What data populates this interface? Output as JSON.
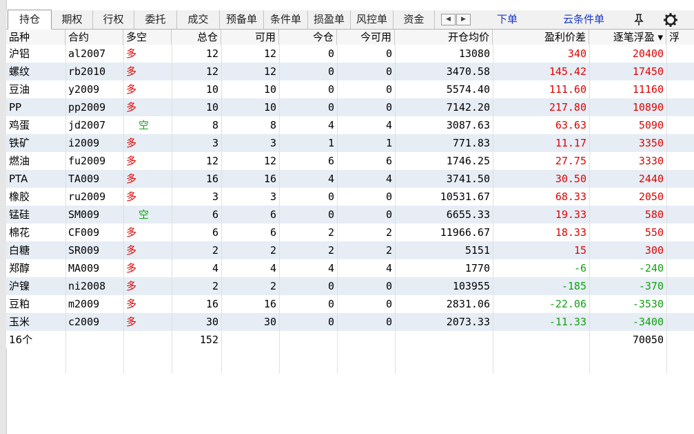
{
  "tabs": [
    {
      "label": "持仓",
      "active": true
    },
    {
      "label": "期权"
    },
    {
      "label": "行权"
    },
    {
      "label": "委托"
    },
    {
      "label": "成交"
    },
    {
      "label": "预备单"
    },
    {
      "label": "条件单"
    },
    {
      "label": "损盈单"
    },
    {
      "label": "风控单"
    },
    {
      "label": "资金"
    }
  ],
  "toolbar": {
    "scroll_left": "◀",
    "scroll_right": "▶",
    "order_link": "下单",
    "cloud_link": "云条件单",
    "pin_icon": "pin-icon",
    "settings_icon": "gear-icon"
  },
  "columns": [
    "品种",
    "合约",
    "多空",
    "总仓",
    "可用",
    "今仓",
    "今可用",
    "开仓均价",
    "盈利价差",
    "逐笔浮盈 ▾",
    "浮"
  ],
  "rows": [
    {
      "variety": "沪铝",
      "contract": "al2007",
      "dir": "多",
      "side": "long",
      "total": "12",
      "avail": "12",
      "today": "0",
      "today_avail": "0",
      "avg_price": "13080",
      "spread": "340",
      "float_pnl": "20400",
      "sign": "pos"
    },
    {
      "variety": "螺纹",
      "contract": "rb2010",
      "dir": "多",
      "side": "long",
      "total": "12",
      "avail": "12",
      "today": "0",
      "today_avail": "0",
      "avg_price": "3470.58",
      "spread": "145.42",
      "float_pnl": "17450",
      "sign": "pos"
    },
    {
      "variety": "豆油",
      "contract": "y2009",
      "dir": "多",
      "side": "long",
      "total": "10",
      "avail": "10",
      "today": "0",
      "today_avail": "0",
      "avg_price": "5574.40",
      "spread": "111.60",
      "float_pnl": "11160",
      "sign": "pos"
    },
    {
      "variety": "PP",
      "contract": "pp2009",
      "dir": "多",
      "side": "long",
      "total": "10",
      "avail": "10",
      "today": "0",
      "today_avail": "0",
      "avg_price": "7142.20",
      "spread": "217.80",
      "float_pnl": "10890",
      "sign": "pos"
    },
    {
      "variety": "鸡蛋",
      "contract": "jd2007",
      "dir": "空",
      "side": "short",
      "total": "8",
      "avail": "8",
      "today": "4",
      "today_avail": "4",
      "avg_price": "3087.63",
      "spread": "63.63",
      "float_pnl": "5090",
      "sign": "pos"
    },
    {
      "variety": "铁矿",
      "contract": "i2009",
      "dir": "多",
      "side": "long",
      "total": "3",
      "avail": "3",
      "today": "1",
      "today_avail": "1",
      "avg_price": "771.83",
      "spread": "11.17",
      "float_pnl": "3350",
      "sign": "pos"
    },
    {
      "variety": "燃油",
      "contract": "fu2009",
      "dir": "多",
      "side": "long",
      "total": "12",
      "avail": "12",
      "today": "6",
      "today_avail": "6",
      "avg_price": "1746.25",
      "spread": "27.75",
      "float_pnl": "3330",
      "sign": "pos"
    },
    {
      "variety": "PTA",
      "contract": "TA009",
      "dir": "多",
      "side": "long",
      "total": "16",
      "avail": "16",
      "today": "4",
      "today_avail": "4",
      "avg_price": "3741.50",
      "spread": "30.50",
      "float_pnl": "2440",
      "sign": "pos"
    },
    {
      "variety": "橡胶",
      "contract": "ru2009",
      "dir": "多",
      "side": "long",
      "total": "3",
      "avail": "3",
      "today": "0",
      "today_avail": "0",
      "avg_price": "10531.67",
      "spread": "68.33",
      "float_pnl": "2050",
      "sign": "pos"
    },
    {
      "variety": "锰硅",
      "contract": "SM009",
      "dir": "空",
      "side": "short",
      "total": "6",
      "avail": "6",
      "today": "0",
      "today_avail": "0",
      "avg_price": "6655.33",
      "spread": "19.33",
      "float_pnl": "580",
      "sign": "pos"
    },
    {
      "variety": "棉花",
      "contract": "CF009",
      "dir": "多",
      "side": "long",
      "total": "6",
      "avail": "6",
      "today": "2",
      "today_avail": "2",
      "avg_price": "11966.67",
      "spread": "18.33",
      "float_pnl": "550",
      "sign": "pos"
    },
    {
      "variety": "白糖",
      "contract": "SR009",
      "dir": "多",
      "side": "long",
      "total": "2",
      "avail": "2",
      "today": "2",
      "today_avail": "2",
      "avg_price": "5151",
      "spread": "15",
      "float_pnl": "300",
      "sign": "pos"
    },
    {
      "variety": "郑醇",
      "contract": "MA009",
      "dir": "多",
      "side": "long",
      "total": "4",
      "avail": "4",
      "today": "4",
      "today_avail": "4",
      "avg_price": "1770",
      "spread": "-6",
      "float_pnl": "-240",
      "sign": "neg"
    },
    {
      "variety": "沪镍",
      "contract": "ni2008",
      "dir": "多",
      "side": "long",
      "total": "2",
      "avail": "2",
      "today": "0",
      "today_avail": "0",
      "avg_price": "103955",
      "spread": "-185",
      "float_pnl": "-370",
      "sign": "neg"
    },
    {
      "variety": "豆粕",
      "contract": "m2009",
      "dir": "多",
      "side": "long",
      "total": "16",
      "avail": "16",
      "today": "0",
      "today_avail": "0",
      "avg_price": "2831.06",
      "spread": "-22.06",
      "float_pnl": "-3530",
      "sign": "neg"
    },
    {
      "variety": "玉米",
      "contract": "c2009",
      "dir": "多",
      "side": "long",
      "total": "30",
      "avail": "30",
      "today": "0",
      "today_avail": "0",
      "avg_price": "2073.33",
      "spread": "-11.33",
      "float_pnl": "-3400",
      "sign": "neg"
    }
  ],
  "summary": {
    "count": "16个",
    "total": "152",
    "float_pnl": "70050"
  },
  "colors": {
    "long": "#e00000",
    "short": "#11a011",
    "row_alt": "#e6edf5",
    "link": "#1a37c8"
  }
}
